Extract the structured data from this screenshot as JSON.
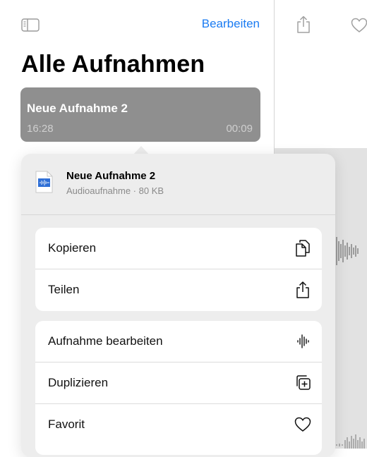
{
  "sidebar": {
    "toggle_icon": "sidebar-toggle-icon",
    "edit_label": "Bearbeiten",
    "title": "Alle Aufnahmen",
    "recording": {
      "name": "Neue Aufnahme 2",
      "time": "16:28",
      "duration": "00:09"
    }
  },
  "detail": {
    "share_icon": "share-icon",
    "favorite_icon": "heart-icon"
  },
  "context_menu": {
    "file": {
      "name": "Neue Aufnahme 2",
      "meta": "Audioaufnahme · 80 KB",
      "icon": "audio-file-icon"
    },
    "groups": [
      {
        "items": [
          {
            "label": "Kopieren",
            "icon": "copy-icon"
          },
          {
            "label": "Teilen",
            "icon": "share-icon"
          }
        ]
      },
      {
        "items": [
          {
            "label": "Aufnahme bearbeiten",
            "icon": "waveform-icon"
          },
          {
            "label": "Duplizieren",
            "icon": "duplicate-icon"
          },
          {
            "label": "Favorit",
            "icon": "heart-icon"
          }
        ]
      }
    ]
  },
  "colors": {
    "accent": "#1a7bf2",
    "selected_row": "#8f8f8f",
    "menu_background": "#ededed"
  }
}
